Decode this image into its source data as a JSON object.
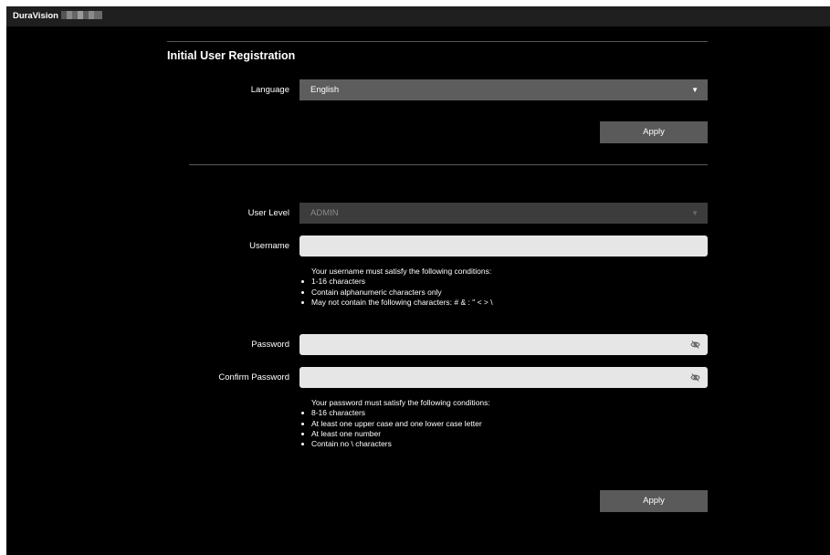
{
  "brand": {
    "name": "DuraVision"
  },
  "page": {
    "title": "Initial User Registration"
  },
  "language": {
    "label": "Language",
    "selected": "English"
  },
  "language_apply": "Apply",
  "user_level": {
    "label": "User Level",
    "selected": "ADMIN",
    "disabled": true
  },
  "username": {
    "label": "Username",
    "value": "",
    "rules_intro": "Your username must satisfy the following conditions:",
    "rules": [
      "1-16 characters",
      "Contain alphanumeric characters only",
      "May not contain the following characters: # & : \" < > \\"
    ]
  },
  "password": {
    "label": "Password",
    "value": ""
  },
  "confirm_password": {
    "label": "Confirm Password",
    "value": ""
  },
  "password_rules": {
    "intro": "Your password must satisfy the following conditions:",
    "rules": [
      "8-16 characters",
      "At least one upper case and one lower case letter",
      "At least one number",
      "Contain no \\ characters"
    ]
  },
  "register_apply": "Apply",
  "icons": {
    "dropdown": "triangle-down-icon",
    "visibility": "eye-slash-icon"
  },
  "colors": {
    "background": "#000000",
    "topbar": "#1f1f1f",
    "select": "#5d5d5d",
    "input": "#e6e6e6",
    "button": "#5a5a5a"
  }
}
